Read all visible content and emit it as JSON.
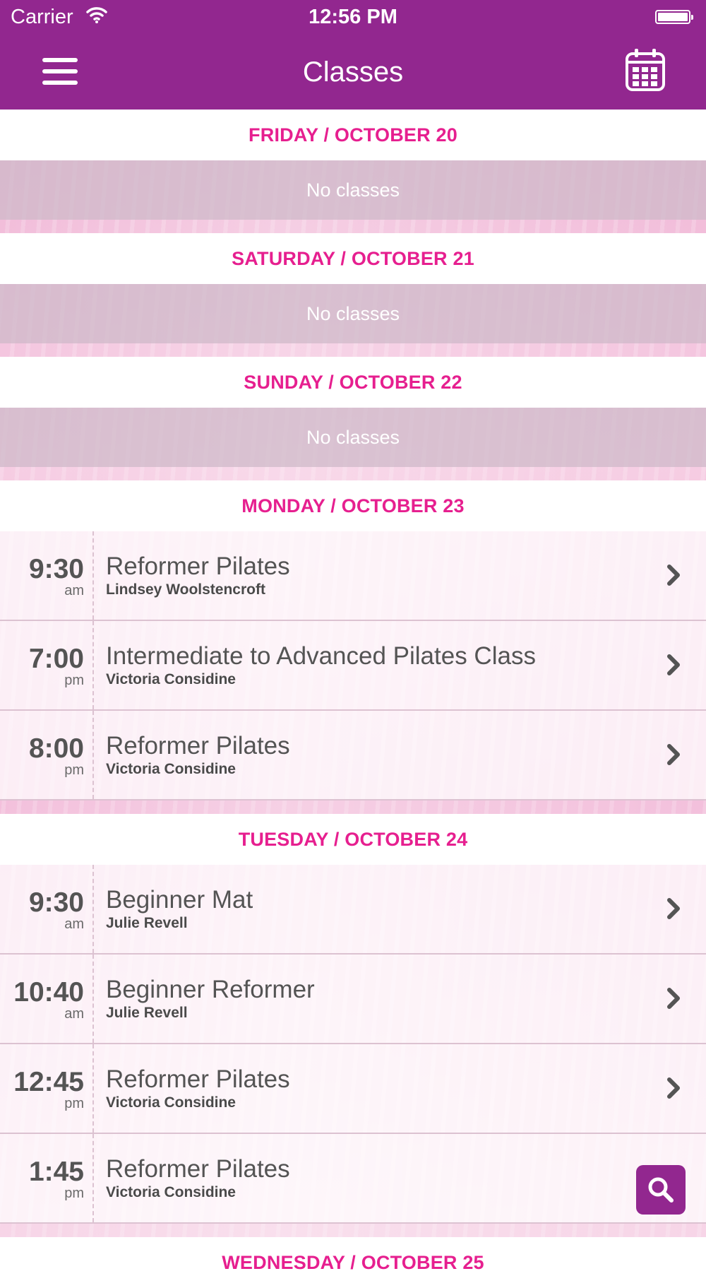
{
  "status_bar": {
    "carrier": "Carrier",
    "time": "12:56 PM"
  },
  "nav": {
    "title": "Classes",
    "menu_icon": "hamburger-menu-icon",
    "calendar_icon": "calendar-icon"
  },
  "colors": {
    "brand_purple": "#92278f",
    "header_pink": "#e61f8f",
    "text_gray": "#545454"
  },
  "days": [
    {
      "header": "FRIDAY / OCTOBER 20",
      "empty_text": "No classes"
    },
    {
      "header": "SATURDAY / OCTOBER 21",
      "empty_text": "No classes"
    },
    {
      "header": "SUNDAY / OCTOBER 22",
      "empty_text": "No classes"
    },
    {
      "header": "MONDAY / OCTOBER 23",
      "classes": [
        {
          "time": "9:30",
          "ampm": "am",
          "name": "Reformer Pilates",
          "instructor": "Lindsey Woolstencroft"
        },
        {
          "time": "7:00",
          "ampm": "pm",
          "name": "Intermediate to Advanced Pilates Class",
          "instructor": "Victoria Considine"
        },
        {
          "time": "8:00",
          "ampm": "pm",
          "name": "Reformer Pilates",
          "instructor": "Victoria Considine"
        }
      ]
    },
    {
      "header": "TUESDAY / OCTOBER 24",
      "classes": [
        {
          "time": "9:30",
          "ampm": "am",
          "name": "Beginner Mat",
          "instructor": "Julie Revell"
        },
        {
          "time": "10:40",
          "ampm": "am",
          "name": "Beginner Reformer",
          "instructor": "Julie Revell"
        },
        {
          "time": "12:45",
          "ampm": "pm",
          "name": "Reformer Pilates",
          "instructor": "Victoria Considine"
        },
        {
          "time": "1:45",
          "ampm": "pm",
          "name": "Reformer Pilates",
          "instructor": "Victoria Considine"
        }
      ]
    },
    {
      "header": "WEDNESDAY / OCTOBER 25"
    }
  ],
  "search_icon": "search-icon"
}
